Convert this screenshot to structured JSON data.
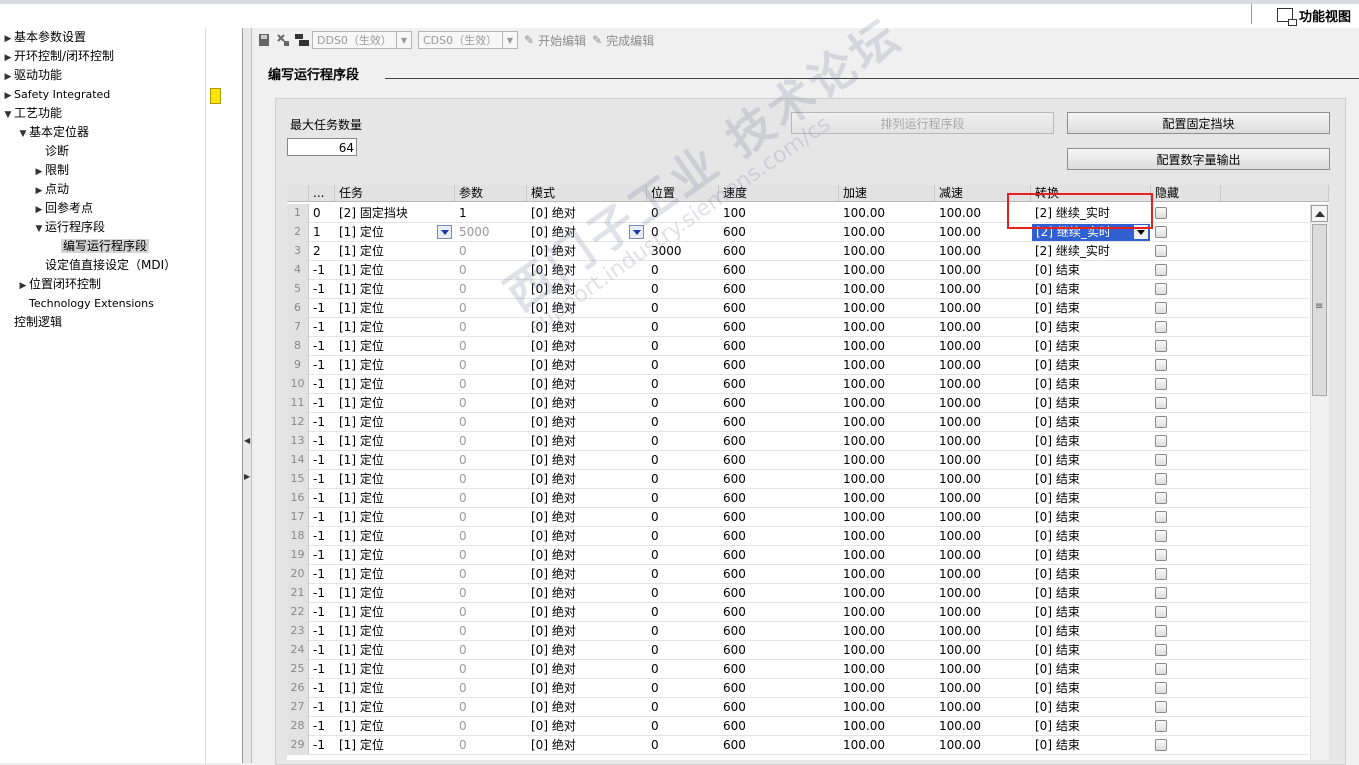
{
  "window": {
    "view_title": "功能视图"
  },
  "tree": {
    "items": [
      {
        "label": "基本参数设置",
        "toggle": "▶",
        "level": 0
      },
      {
        "label": "开环控制/闭环控制",
        "toggle": "▶",
        "level": 0
      },
      {
        "label": "驱动功能",
        "toggle": "▶",
        "level": 0
      },
      {
        "label": "Safety Integrated",
        "toggle": "▶",
        "level": 0
      },
      {
        "label": "工艺功能",
        "toggle": "▼",
        "level": 0
      },
      {
        "label": "基本定位器",
        "toggle": "▼",
        "level": 1
      },
      {
        "label": "诊断",
        "toggle": "",
        "level": 2
      },
      {
        "label": "限制",
        "toggle": "▶",
        "level": 2
      },
      {
        "label": "点动",
        "toggle": "▶",
        "level": 2
      },
      {
        "label": "回参考点",
        "toggle": "▶",
        "level": 2
      },
      {
        "label": "运行程序段",
        "toggle": "▼",
        "level": 2
      },
      {
        "label": "编写运行程序段",
        "toggle": "",
        "level": 3
      },
      {
        "label": "设定值直接设定（MDI）",
        "toggle": "",
        "level": 2
      },
      {
        "label": "位置闭环控制",
        "toggle": "▶",
        "level": 1
      },
      {
        "label": "Technology Extensions",
        "toggle": "",
        "level": 1
      },
      {
        "label": "控制逻辑",
        "toggle": "",
        "level": 0
      }
    ]
  },
  "toolbar": {
    "dds_value": "DDS0（生效）",
    "cds_value": "CDS0（生效）",
    "start_edit": "开始编辑",
    "finish_edit": "完成编辑"
  },
  "section": {
    "title": "编写运行程序段"
  },
  "panel": {
    "max_tasks_label": "最大任务数量",
    "max_tasks_value": "64",
    "sort_button": "排列运行程序段",
    "fixed_stop_button": "配置固定挡块",
    "digital_output_button": "配置数字量输出"
  },
  "table": {
    "headers": [
      "",
      "...",
      "任务",
      "参数",
      "模式",
      "位置",
      "速度",
      "加速",
      "减速",
      "转换",
      "隐藏"
    ],
    "rows": [
      [
        "1",
        "0",
        "[2] 固定挡块",
        "1",
        "[0] 绝对",
        "0",
        "100",
        "100.00",
        "100.00",
        "[2] 继续_实时"
      ],
      [
        "2",
        "1",
        "[1] 定位",
        "5000",
        "[0] 绝对",
        "0",
        "600",
        "100.00",
        "100.00",
        "[2] 继续_实时"
      ],
      [
        "3",
        "2",
        "[1] 定位",
        "0",
        "[0] 绝对",
        "3000",
        "600",
        "100.00",
        "100.00",
        "[2] 继续_实时"
      ],
      [
        "4",
        "-1",
        "[1] 定位",
        "0",
        "[0] 绝对",
        "0",
        "600",
        "100.00",
        "100.00",
        "[0] 结束"
      ],
      [
        "5",
        "-1",
        "[1] 定位",
        "0",
        "[0] 绝对",
        "0",
        "600",
        "100.00",
        "100.00",
        "[0] 结束"
      ],
      [
        "6",
        "-1",
        "[1] 定位",
        "0",
        "[0] 绝对",
        "0",
        "600",
        "100.00",
        "100.00",
        "[0] 结束"
      ],
      [
        "7",
        "-1",
        "[1] 定位",
        "0",
        "[0] 绝对",
        "0",
        "600",
        "100.00",
        "100.00",
        "[0] 结束"
      ],
      [
        "8",
        "-1",
        "[1] 定位",
        "0",
        "[0] 绝对",
        "0",
        "600",
        "100.00",
        "100.00",
        "[0] 结束"
      ],
      [
        "9",
        "-1",
        "[1] 定位",
        "0",
        "[0] 绝对",
        "0",
        "600",
        "100.00",
        "100.00",
        "[0] 结束"
      ],
      [
        "10",
        "-1",
        "[1] 定位",
        "0",
        "[0] 绝对",
        "0",
        "600",
        "100.00",
        "100.00",
        "[0] 结束"
      ],
      [
        "11",
        "-1",
        "[1] 定位",
        "0",
        "[0] 绝对",
        "0",
        "600",
        "100.00",
        "100.00",
        "[0] 结束"
      ],
      [
        "12",
        "-1",
        "[1] 定位",
        "0",
        "[0] 绝对",
        "0",
        "600",
        "100.00",
        "100.00",
        "[0] 结束"
      ],
      [
        "13",
        "-1",
        "[1] 定位",
        "0",
        "[0] 绝对",
        "0",
        "600",
        "100.00",
        "100.00",
        "[0] 结束"
      ],
      [
        "14",
        "-1",
        "[1] 定位",
        "0",
        "[0] 绝对",
        "0",
        "600",
        "100.00",
        "100.00",
        "[0] 结束"
      ],
      [
        "15",
        "-1",
        "[1] 定位",
        "0",
        "[0] 绝对",
        "0",
        "600",
        "100.00",
        "100.00",
        "[0] 结束"
      ],
      [
        "16",
        "-1",
        "[1] 定位",
        "0",
        "[0] 绝对",
        "0",
        "600",
        "100.00",
        "100.00",
        "[0] 结束"
      ],
      [
        "17",
        "-1",
        "[1] 定位",
        "0",
        "[0] 绝对",
        "0",
        "600",
        "100.00",
        "100.00",
        "[0] 结束"
      ],
      [
        "18",
        "-1",
        "[1] 定位",
        "0",
        "[0] 绝对",
        "0",
        "600",
        "100.00",
        "100.00",
        "[0] 结束"
      ],
      [
        "19",
        "-1",
        "[1] 定位",
        "0",
        "[0] 绝对",
        "0",
        "600",
        "100.00",
        "100.00",
        "[0] 结束"
      ],
      [
        "20",
        "-1",
        "[1] 定位",
        "0",
        "[0] 绝对",
        "0",
        "600",
        "100.00",
        "100.00",
        "[0] 结束"
      ],
      [
        "21",
        "-1",
        "[1] 定位",
        "0",
        "[0] 绝对",
        "0",
        "600",
        "100.00",
        "100.00",
        "[0] 结束"
      ],
      [
        "22",
        "-1",
        "[1] 定位",
        "0",
        "[0] 绝对",
        "0",
        "600",
        "100.00",
        "100.00",
        "[0] 结束"
      ],
      [
        "23",
        "-1",
        "[1] 定位",
        "0",
        "[0] 绝对",
        "0",
        "600",
        "100.00",
        "100.00",
        "[0] 结束"
      ],
      [
        "24",
        "-1",
        "[1] 定位",
        "0",
        "[0] 绝对",
        "0",
        "600",
        "100.00",
        "100.00",
        "[0] 结束"
      ],
      [
        "25",
        "-1",
        "[1] 定位",
        "0",
        "[0] 绝对",
        "0",
        "600",
        "100.00",
        "100.00",
        "[0] 结束"
      ],
      [
        "26",
        "-1",
        "[1] 定位",
        "0",
        "[0] 绝对",
        "0",
        "600",
        "100.00",
        "100.00",
        "[0] 结束"
      ],
      [
        "27",
        "-1",
        "[1] 定位",
        "0",
        "[0] 绝对",
        "0",
        "600",
        "100.00",
        "100.00",
        "[0] 结束"
      ],
      [
        "28",
        "-1",
        "[1] 定位",
        "0",
        "[0] 绝对",
        "0",
        "600",
        "100.00",
        "100.00",
        "[0] 结束"
      ],
      [
        "29",
        "-1",
        "[1] 定位",
        "0",
        "[0] 绝对",
        "0",
        "600",
        "100.00",
        "100.00",
        "[0] 结束"
      ]
    ]
  },
  "watermark": {
    "line1": "西门子工业  技术论坛",
    "line2": "support.industry.siemens.com/cs"
  },
  "colors": {
    "highlight": "#e52020",
    "selection": "#2f5fd0",
    "safety_marker": "#ffe600"
  }
}
